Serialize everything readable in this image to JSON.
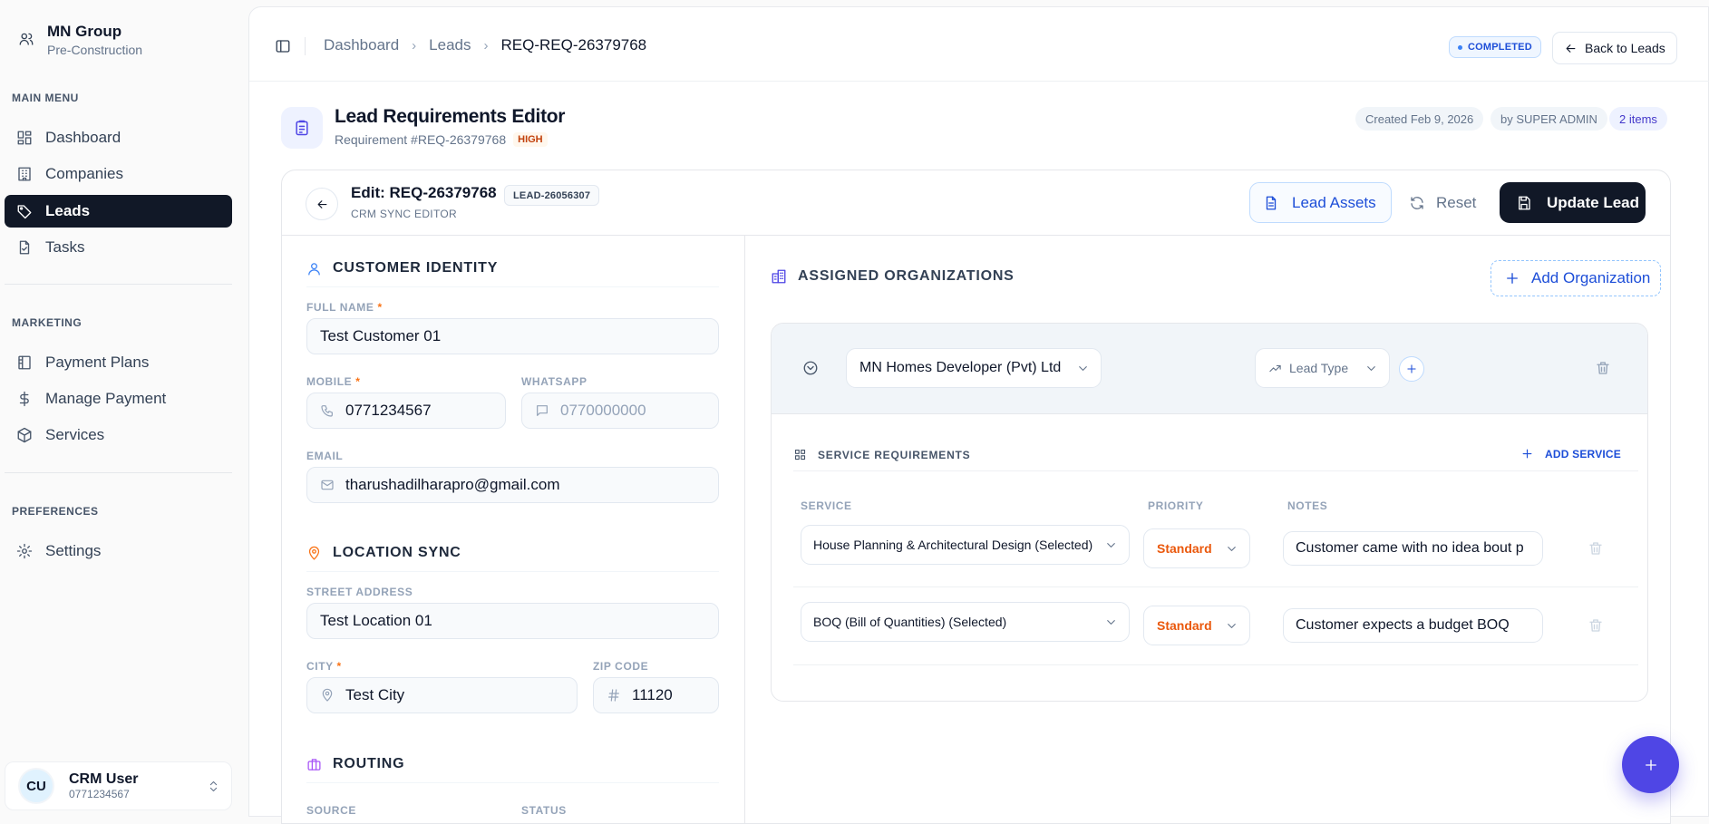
{
  "brand": {
    "name": "MN Group",
    "subtitle": "Pre-Construction"
  },
  "sidebar": {
    "main_menu_title": "MAIN MENU",
    "main_items": [
      {
        "label": "Dashboard",
        "icon": "dashboard-icon"
      },
      {
        "label": "Companies",
        "icon": "building-icon"
      },
      {
        "label": "Leads",
        "icon": "tag-icon",
        "active": true
      },
      {
        "label": "Tasks",
        "icon": "file-check-icon"
      }
    ],
    "marketing_title": "MARKETING",
    "marketing_items": [
      {
        "label": "Payment Plans",
        "icon": "columns-icon"
      },
      {
        "label": "Manage Payment",
        "icon": "dollar-icon"
      },
      {
        "label": "Services",
        "icon": "package-icon"
      }
    ],
    "preferences_title": "PREFERENCES",
    "preferences_items": [
      {
        "label": "Settings",
        "icon": "gear-icon"
      }
    ]
  },
  "user": {
    "initials": "CU",
    "name": "CRM User",
    "phone": "0771234567"
  },
  "breadcrumb": {
    "items": [
      "Dashboard",
      "Leads"
    ],
    "current": "REQ-REQ-26379768"
  },
  "status_badge": "COMPLETED",
  "back_button": "Back to Leads",
  "page_header": {
    "title": "Lead Requirements Editor",
    "subtitle": "Requirement #REQ-26379768",
    "priority_tag": "HIGH",
    "created": "Created Feb 9, 2026",
    "by": "by SUPER ADMIN",
    "items": "2 items"
  },
  "editor": {
    "title": "Edit: REQ-26379768",
    "lead_tag": "LEAD-26056307",
    "subtitle": "CRM SYNC EDITOR",
    "assets_button": "Lead Assets",
    "reset_button": "Reset",
    "update_button": "Update Lead"
  },
  "customer": {
    "section_title": "CUSTOMER IDENTITY",
    "full_name_label": "FULL NAME",
    "full_name": "Test Customer 01",
    "mobile_label": "MOBILE",
    "mobile": "0771234567",
    "whatsapp_label": "WHATSAPP",
    "whatsapp_placeholder": "0770000000",
    "email_label": "EMAIL",
    "email": "tharushadilharapro@gmail.com"
  },
  "location": {
    "section_title": "LOCATION SYNC",
    "street_label": "STREET ADDRESS",
    "street": "Test Location 01",
    "city_label": "CITY",
    "city": "Test City",
    "zip_label": "ZIP CODE",
    "zip": "11120"
  },
  "routing": {
    "section_title": "ROUTING",
    "source_label": "SOURCE",
    "status_label": "STATUS"
  },
  "organizations": {
    "section_title": "ASSIGNED ORGANIZATIONS",
    "add_button": "Add Organization",
    "org_name": "MN Homes Developer (Pvt) Ltd",
    "lead_type": "Lead Type",
    "services_title": "SERVICE REQUIREMENTS",
    "add_service": "ADD SERVICE",
    "headers": {
      "service": "SERVICE",
      "priority": "PRIORITY",
      "notes": "NOTES"
    },
    "rows": [
      {
        "service": "House Planning & Architectural Design (Selected)",
        "priority": "Standard",
        "notes": "Customer came with no idea bout p"
      },
      {
        "service": "BOQ (Bill of Quantities) (Selected)",
        "priority": "Standard",
        "notes": "Customer expects a budget BOQ"
      }
    ]
  },
  "colors": {
    "accent": "#4f46e5",
    "primary_dark": "#111827",
    "link_blue": "#1d4ed8",
    "priority_orange": "#ea580c"
  }
}
